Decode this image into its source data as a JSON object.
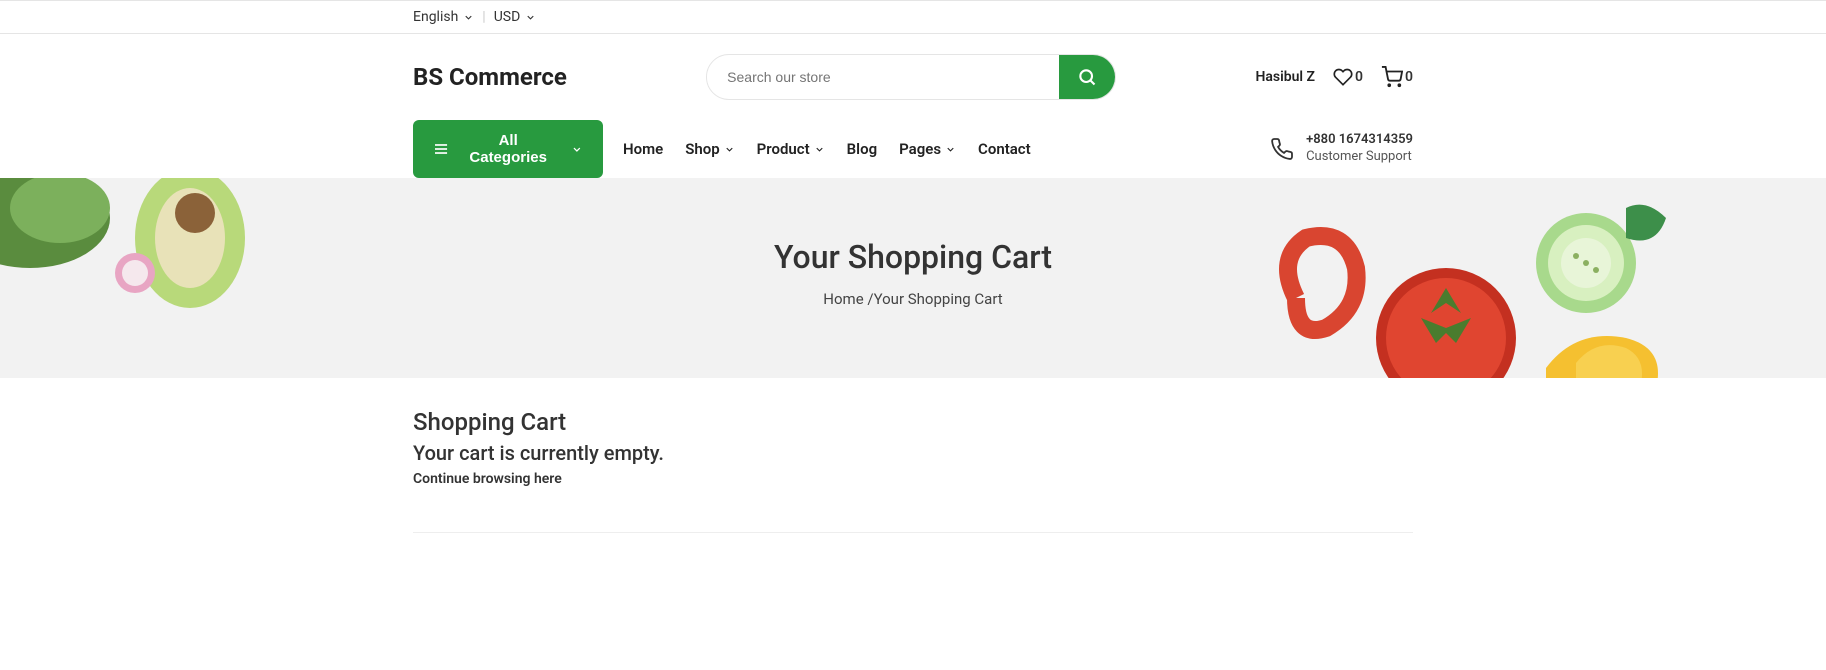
{
  "topbar": {
    "language": "English",
    "currency": "USD"
  },
  "header": {
    "logo": "BS Commerce",
    "search_placeholder": "Search our store",
    "user_name": "Hasibul Z",
    "wishlist_count": "0",
    "cart_count": "0"
  },
  "nav": {
    "categories_label": "All Categories",
    "links": {
      "home": "Home",
      "shop": "Shop",
      "product": "Product",
      "blog": "Blog",
      "pages": "Pages",
      "contact": "Contact"
    },
    "support": {
      "phone": "+880 1674314359",
      "label": "Customer Support"
    }
  },
  "banner": {
    "title": "Your Shopping Cart",
    "breadcrumb_home": "Home",
    "breadcrumb_separator": " /",
    "breadcrumb_current": "Your Shopping Cart"
  },
  "cart": {
    "title": "Shopping Cart",
    "empty_message": "Your cart is currently empty.",
    "continue_text": "Continue browsing here"
  }
}
